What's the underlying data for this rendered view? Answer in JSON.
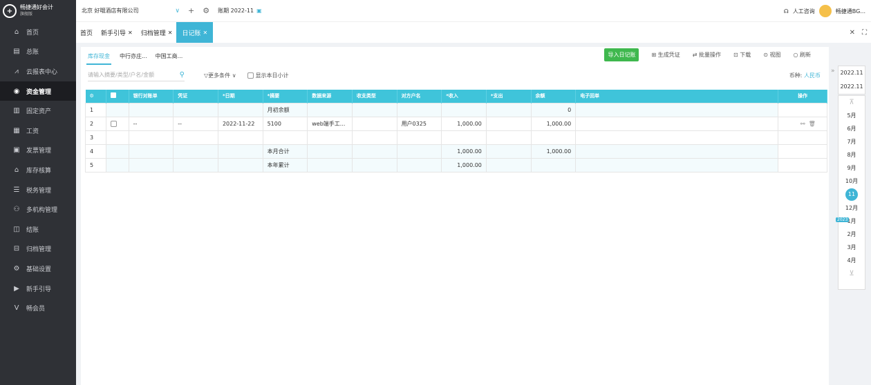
{
  "app": {
    "logo_title": "畅捷通好会计",
    "logo_sub": "旗舰版"
  },
  "sidebar": {
    "items": [
      {
        "label": "首页",
        "icon": "home-icon",
        "glyph": "⌂"
      },
      {
        "label": "总账",
        "icon": "ledger-icon",
        "glyph": "▤"
      },
      {
        "label": "云报表中心",
        "icon": "chart-icon",
        "glyph": "⩘"
      },
      {
        "label": "资金管理",
        "icon": "fund-icon",
        "glyph": "◉"
      },
      {
        "label": "固定资产",
        "icon": "asset-icon",
        "glyph": "▥"
      },
      {
        "label": "工资",
        "icon": "salary-icon",
        "glyph": "▦"
      },
      {
        "label": "发票管理",
        "icon": "invoice-icon",
        "glyph": "▣"
      },
      {
        "label": "库存核算",
        "icon": "inventory-icon",
        "glyph": "⌂"
      },
      {
        "label": "税务管理",
        "icon": "tax-icon",
        "glyph": "☰"
      },
      {
        "label": "多机构管理",
        "icon": "org-icon",
        "glyph": "⚇"
      },
      {
        "label": "结账",
        "icon": "close-account-icon",
        "glyph": "◫"
      },
      {
        "label": "归档管理",
        "icon": "archive-icon",
        "glyph": "⊟"
      },
      {
        "label": "基础设置",
        "icon": "settings-icon",
        "glyph": "⚙"
      },
      {
        "label": "新手引导",
        "icon": "guide-icon",
        "glyph": "▶"
      },
      {
        "label": "畅会员",
        "icon": "vip-icon",
        "glyph": "V"
      }
    ]
  },
  "topbar": {
    "company": "北京 好哦酒店有限公司",
    "period_label": "账期",
    "period_value": "2022-11",
    "service": "人工咨询",
    "user": "畅捷通BG..."
  },
  "tabs": [
    {
      "label": "首页",
      "closable": false
    },
    {
      "label": "新手引导",
      "closable": true
    },
    {
      "label": "归档管理",
      "closable": true
    },
    {
      "label": "日记账",
      "closable": true,
      "active": true
    }
  ],
  "subtabs": [
    "库存现金",
    "中行亦庄...",
    "中国工商..."
  ],
  "actions": {
    "import": "导入日记账",
    "gen_voucher": "生成凭证",
    "batch": "批量操作",
    "download": "下载",
    "view": "视图",
    "refresh": "刷新"
  },
  "filter": {
    "placeholder": "请输入摘要/类型/户名/金额",
    "more": "更多条件",
    "show_subtotal": "显示本日小计",
    "currency_label": "币种:",
    "currency_value": "人民币"
  },
  "table": {
    "headers": [
      "银行对账单",
      "凭证",
      "日期",
      "摘要",
      "数据来源",
      "收支类型",
      "对方户名",
      "收入",
      "支出",
      "余额",
      "电子回单",
      "操作"
    ],
    "rows": [
      {
        "no": "1",
        "summary": "月初余额",
        "balance": "0"
      },
      {
        "no": "2",
        "bank": "--",
        "voucher": "--",
        "date": "2022-11-22",
        "summary": "5100",
        "source": "web端手工...",
        "partner": "用户0325",
        "income": "1,000.00",
        "balance": "1,000.00"
      },
      {
        "no": "3"
      },
      {
        "no": "4",
        "summary": "本月合计",
        "income": "1,000.00",
        "balance": "1,000.00"
      },
      {
        "no": "5",
        "summary": "本年累计",
        "income": "1,000.00"
      }
    ]
  },
  "period_nav": {
    "years": [
      "2022.11",
      "2022.11"
    ],
    "months": [
      "5月",
      "6月",
      "7月",
      "8月",
      "9月",
      "10月",
      "11月",
      "12月",
      "1月",
      "2月",
      "3月",
      "4月"
    ],
    "current": "11月",
    "year_badge": "2023"
  }
}
